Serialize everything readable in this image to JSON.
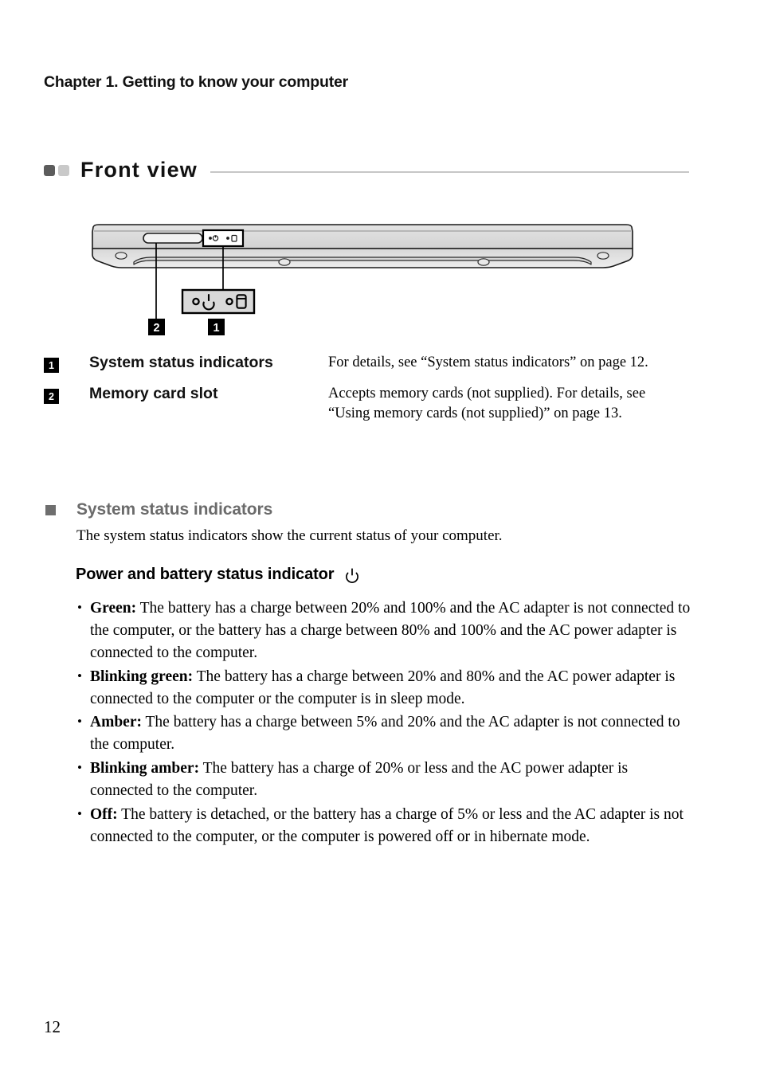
{
  "document": {
    "chapter_header": "Chapter 1. Getting to know your computer",
    "page_number": "12"
  },
  "section": {
    "title": "Front view",
    "marker_dark_color": "#5c5c5c",
    "marker_light_color": "#c9c9c9",
    "rule_color": "#c6c6c6"
  },
  "figure": {
    "name": "laptop-front-edge-illustration",
    "callouts": [
      {
        "number": "2",
        "target": "memory-card-slot"
      },
      {
        "number": "1",
        "target": "system-status-indicators"
      }
    ],
    "detail_box": {
      "icons": [
        {
          "name": "power-indicator-icon",
          "glyph": "power"
        },
        {
          "name": "storage-indicator-icon",
          "glyph": "hard-disk"
        }
      ]
    }
  },
  "definitions": [
    {
      "badge": "1",
      "term": "System status indicators",
      "description": "For details, see “System status indicators” on page 12."
    },
    {
      "badge": "2",
      "term": "Memory card slot",
      "description": "Accepts memory cards (not supplied). For details, see “Using memory cards (not supplied)” on page 13."
    }
  ],
  "subsection": {
    "title": "System status indicators",
    "bullet_color": "#6e6e6e",
    "title_color": "#6b6b6b",
    "intro": "The system status indicators show the current status of your computer."
  },
  "power_indicator": {
    "heading": "Power and battery status indicator",
    "icon": "power-icon",
    "bullets": [
      {
        "lead": "Green:",
        "text": " The battery has a charge between 20% and 100% and the AC adapter is not connected to the computer, or the battery has a charge between 80% and 100% and the AC power adapter is connected to the computer."
      },
      {
        "lead": "Blinking green:",
        "text": " The battery has a charge between 20% and 80% and the AC power adapter is connected to the computer or the computer is in sleep mode."
      },
      {
        "lead": "Amber:",
        "text": " The battery has a charge between 5% and 20% and the AC adapter is not connected to the computer."
      },
      {
        "lead": "Blinking amber:",
        "text": " The battery has a charge of 20% or less and the AC power adapter is connected to the computer."
      },
      {
        "lead": "Off:",
        "text": " The battery is detached, or the battery has a charge of 5% or less and the AC adapter is not connected to the computer, or the computer is powered off or in hibernate mode."
      }
    ]
  }
}
